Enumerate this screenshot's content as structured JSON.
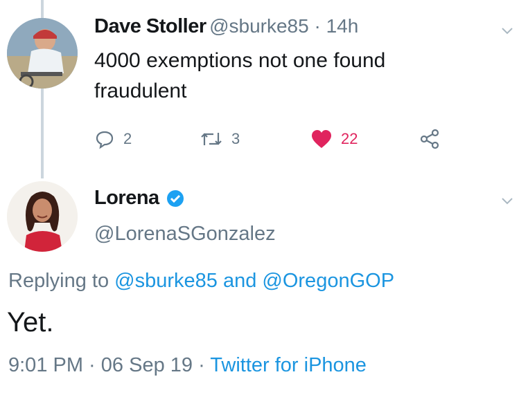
{
  "tweet1": {
    "name": "Dave Stoller",
    "handle": "@sburke85",
    "separator": " · ",
    "time": "14h",
    "text": "4000 exemptions not one found fraudulent",
    "actions": {
      "replies": "2",
      "retweets": "3",
      "likes": "22"
    }
  },
  "tweet2": {
    "name": "Lorena",
    "handle": "@LorenaSGonzalez",
    "replying_prefix": "Replying to ",
    "reply_to_1": "@sburke85",
    "reply_and": " and ",
    "reply_to_2": "@OregonGOP",
    "text": "Yet.",
    "time": "9:01 PM",
    "sep1": " · ",
    "date": "06 Sep 19",
    "sep2": " · ",
    "source": "Twitter for iPhone"
  },
  "colors": {
    "accent": "#1b95e0",
    "like": "#e0245e",
    "muted": "#657786",
    "thread_line": "#ccd6dd"
  },
  "icons": [
    "reply-icon",
    "retweet-icon",
    "like-icon",
    "share-icon",
    "chevron-down-icon",
    "verified-badge-icon"
  ]
}
